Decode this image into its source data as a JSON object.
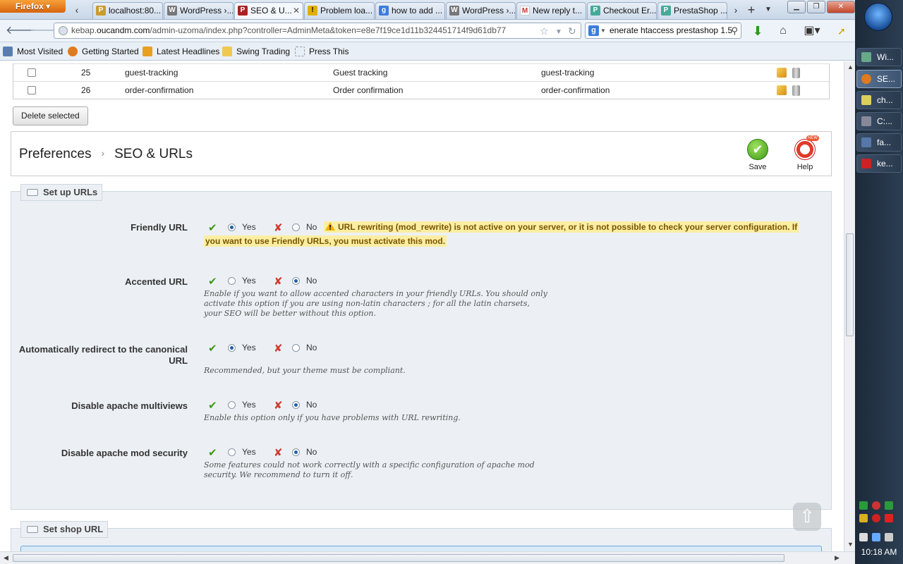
{
  "browser": {
    "menu_button": "Firefox",
    "tabs": [
      {
        "label": "localhost:80...",
        "icon": "phpmyadmin-icon",
        "color": "#c93"
      },
      {
        "label": "WordPress ›...",
        "icon": "wordpress-icon",
        "color": "#777"
      },
      {
        "label": "SEO & U...",
        "icon": "prestashop-icon",
        "color": "#a22",
        "active": true
      },
      {
        "label": "Problem loa...",
        "icon": "warning-icon",
        "color": "#e0b000"
      },
      {
        "label": "how to add ...",
        "icon": "google-icon",
        "color": "#3b7ddd"
      },
      {
        "label": "WordPress ›...",
        "icon": "wordpress-icon",
        "color": "#777"
      },
      {
        "label": "New reply t...",
        "icon": "gmail-icon",
        "color": "#c33"
      },
      {
        "label": "Checkout Er...",
        "icon": "prestashop-forum-icon",
        "color": "#4a9"
      },
      {
        "label": "PrestaShop ...",
        "icon": "prestashop-forum-icon",
        "color": "#4a9"
      }
    ],
    "url_scheme_host": "kebap.",
    "url_domain": "oucandm.com",
    "url_path": "/admin-uzoma/index.php?controller=AdminMeta&token=e8e7f19ce1d11b324451714f9d61db77",
    "search_text": "enerate htaccess prestashop 1.5",
    "bookmarks": [
      {
        "label": "Most Visited",
        "icon": "most-visited-icon",
        "color": "#5a7db0"
      },
      {
        "label": "Getting Started",
        "icon": "firefox-icon",
        "color": "#e07a20"
      },
      {
        "label": "Latest Headlines",
        "icon": "rss-icon",
        "color": "#e8a020"
      },
      {
        "label": "Swing Trading",
        "icon": "folder-icon",
        "color": "#f0c850"
      },
      {
        "label": "Press This",
        "icon": "bookmarklet-icon",
        "color": "#bbb"
      }
    ]
  },
  "table": {
    "rows": [
      {
        "id": "25",
        "page": "guest-tracking",
        "title": "Guest tracking",
        "rewrite": "guest-tracking"
      },
      {
        "id": "26",
        "page": "order-confirmation",
        "title": "Order confirmation",
        "rewrite": "order-confirmation"
      }
    ],
    "delete_selected": "Delete selected"
  },
  "toolbar": {
    "crumb_parent": "Preferences",
    "crumb_sep": "›",
    "crumb_current": "SEO & URLs",
    "save_label": "Save",
    "help_label": "Help"
  },
  "setup": {
    "legend": "Set up URLs",
    "yes": "Yes",
    "no": "No",
    "friendly_url": {
      "label": "Friendly URL",
      "selected": "yes",
      "warning": "URL rewriting (mod_rewrite) is not active on your server, or it is not possible to check your server configuration. If you want to use Friendly URLs, you must activate this mod."
    },
    "accented_url": {
      "label": "Accented URL",
      "selected": "no",
      "hint": "Enable if you want to allow accented characters in your friendly URLs. You should only activate this option if you are using non-latin characters ; for all the latin charsets, your SEO will be better without this option."
    },
    "canonical_redirect": {
      "label": "Automatically redirect to the canonical URL",
      "selected": "yes",
      "hint": "Recommended, but your theme must be compliant."
    },
    "multiviews": {
      "label": "Disable apache multiviews",
      "selected": "no",
      "hint": "Enable this option only if you have problems with URL rewriting."
    },
    "mod_security": {
      "label": "Disable apache mod security",
      "selected": "no",
      "hint": "Some features could not work correctly with a specific configuration of apache mod security. We recommend to turn it off."
    }
  },
  "shop_url": {
    "legend": "Set shop URL"
  },
  "taskbar": {
    "items": [
      {
        "label": "Wi...",
        "icon": "monitor-icon",
        "color": "#6a8"
      },
      {
        "label": "SE...",
        "icon": "firefox-icon",
        "color": "#e07a20",
        "active": true
      },
      {
        "label": "ch...",
        "icon": "document-icon",
        "color": "#d9d060"
      },
      {
        "label": "C:...",
        "icon": "cmd-icon",
        "color": "#889"
      },
      {
        "label": "fa...",
        "icon": "document-icon",
        "color": "#57a"
      },
      {
        "label": "ke...",
        "icon": "filezilla-icon",
        "color": "#c22"
      }
    ],
    "clock": "10:18 AM"
  }
}
